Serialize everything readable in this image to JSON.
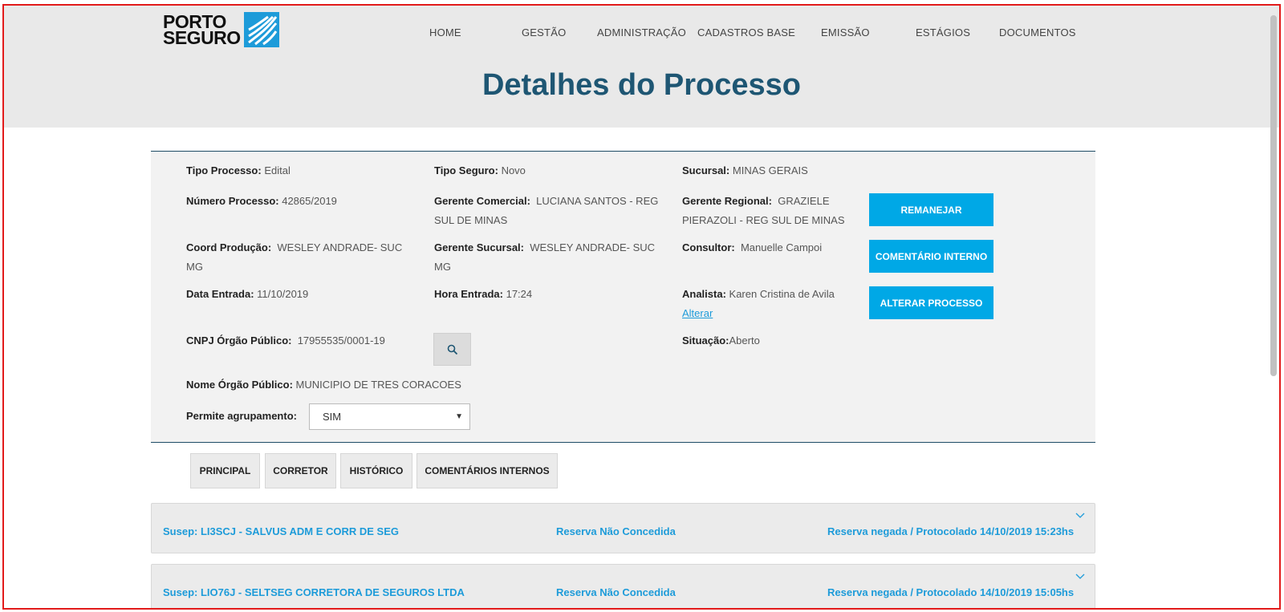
{
  "brand": {
    "line1": "PORTO",
    "line2": "SEGURO"
  },
  "nav": [
    "HOME",
    "GESTÃO",
    "ADMINISTRAÇÃO",
    "CADASTROS BASE",
    "EMISSÃO",
    "ESTÁGIOS",
    "DOCUMENTOS"
  ],
  "page_title": "Detalhes do Processo",
  "details": {
    "tipo_processo": {
      "label": "Tipo Processo:",
      "value": "Edital"
    },
    "tipo_seguro": {
      "label": "Tipo Seguro:",
      "value": "Novo"
    },
    "sucursal": {
      "label": "Sucursal:",
      "value": "MINAS GERAIS"
    },
    "numero_processo": {
      "label": "Número Processo:",
      "value": "42865/2019"
    },
    "gerente_comercial": {
      "label": "Gerente Comercial:",
      "value": "LUCIANA SANTOS - REG SUL DE MINAS"
    },
    "gerente_regional": {
      "label": "Gerente Regional:",
      "value": "GRAZIELE PIERAZOLI - REG SUL DE MINAS"
    },
    "coord_producao": {
      "label": "Coord Produção:",
      "value": "WESLEY ANDRADE- SUC MG"
    },
    "gerente_sucursal": {
      "label": "Gerente Sucursal:",
      "value": "WESLEY ANDRADE- SUC MG"
    },
    "consultor": {
      "label": "Consultor:",
      "value": "Manuelle Campoi"
    },
    "data_entrada": {
      "label": "Data Entrada:",
      "value": "11/10/2019"
    },
    "hora_entrada": {
      "label": "Hora Entrada:",
      "value": "17:24"
    },
    "analista": {
      "label": "Analista:",
      "value": "Karen Cristina de Avila",
      "link": "Alterar"
    },
    "cnpj": {
      "label": "CNPJ Órgão Público:",
      "value": "17955535/0001-19"
    },
    "situacao": {
      "label": "Situação:",
      "value": "Aberto"
    },
    "nome_orgao": {
      "label": "Nome Órgão Público:",
      "value": "MUNICIPIO DE TRES CORACOES"
    },
    "agrupamento": {
      "label": "Permite agrupamento:",
      "selected": "SIM"
    }
  },
  "buttons": {
    "remanejar": "REMANEJAR",
    "comentario": "COMENTÁRIO INTERNO",
    "alterar": "ALTERAR PROCESSO"
  },
  "tabs": [
    "PRINCIPAL",
    "CORRETOR",
    "HISTÓRICO",
    "COMENTÁRIOS INTERNOS"
  ],
  "rows": [
    {
      "susep": "Susep: LI3SCJ - SALVUS ADM E CORR DE SEG",
      "status": "Reserva Não Concedida",
      "result": "Reserva negada / Protocolado 14/10/2019 15:23hs"
    },
    {
      "susep": "Susep: LIO76J - SELTSEG CORRETORA DE SEGUROS LTDA",
      "status": "Reserva Não Concedida",
      "result": "Reserva negada / Protocolado 14/10/2019 15:05hs"
    }
  ],
  "colors": {
    "accent": "#00a8e6",
    "title": "#1e5673",
    "link": "#1d9bd9"
  },
  "icons": {
    "search": "search-icon",
    "chevron": "chevron-down-icon",
    "select_caret": "caret-down-icon"
  }
}
